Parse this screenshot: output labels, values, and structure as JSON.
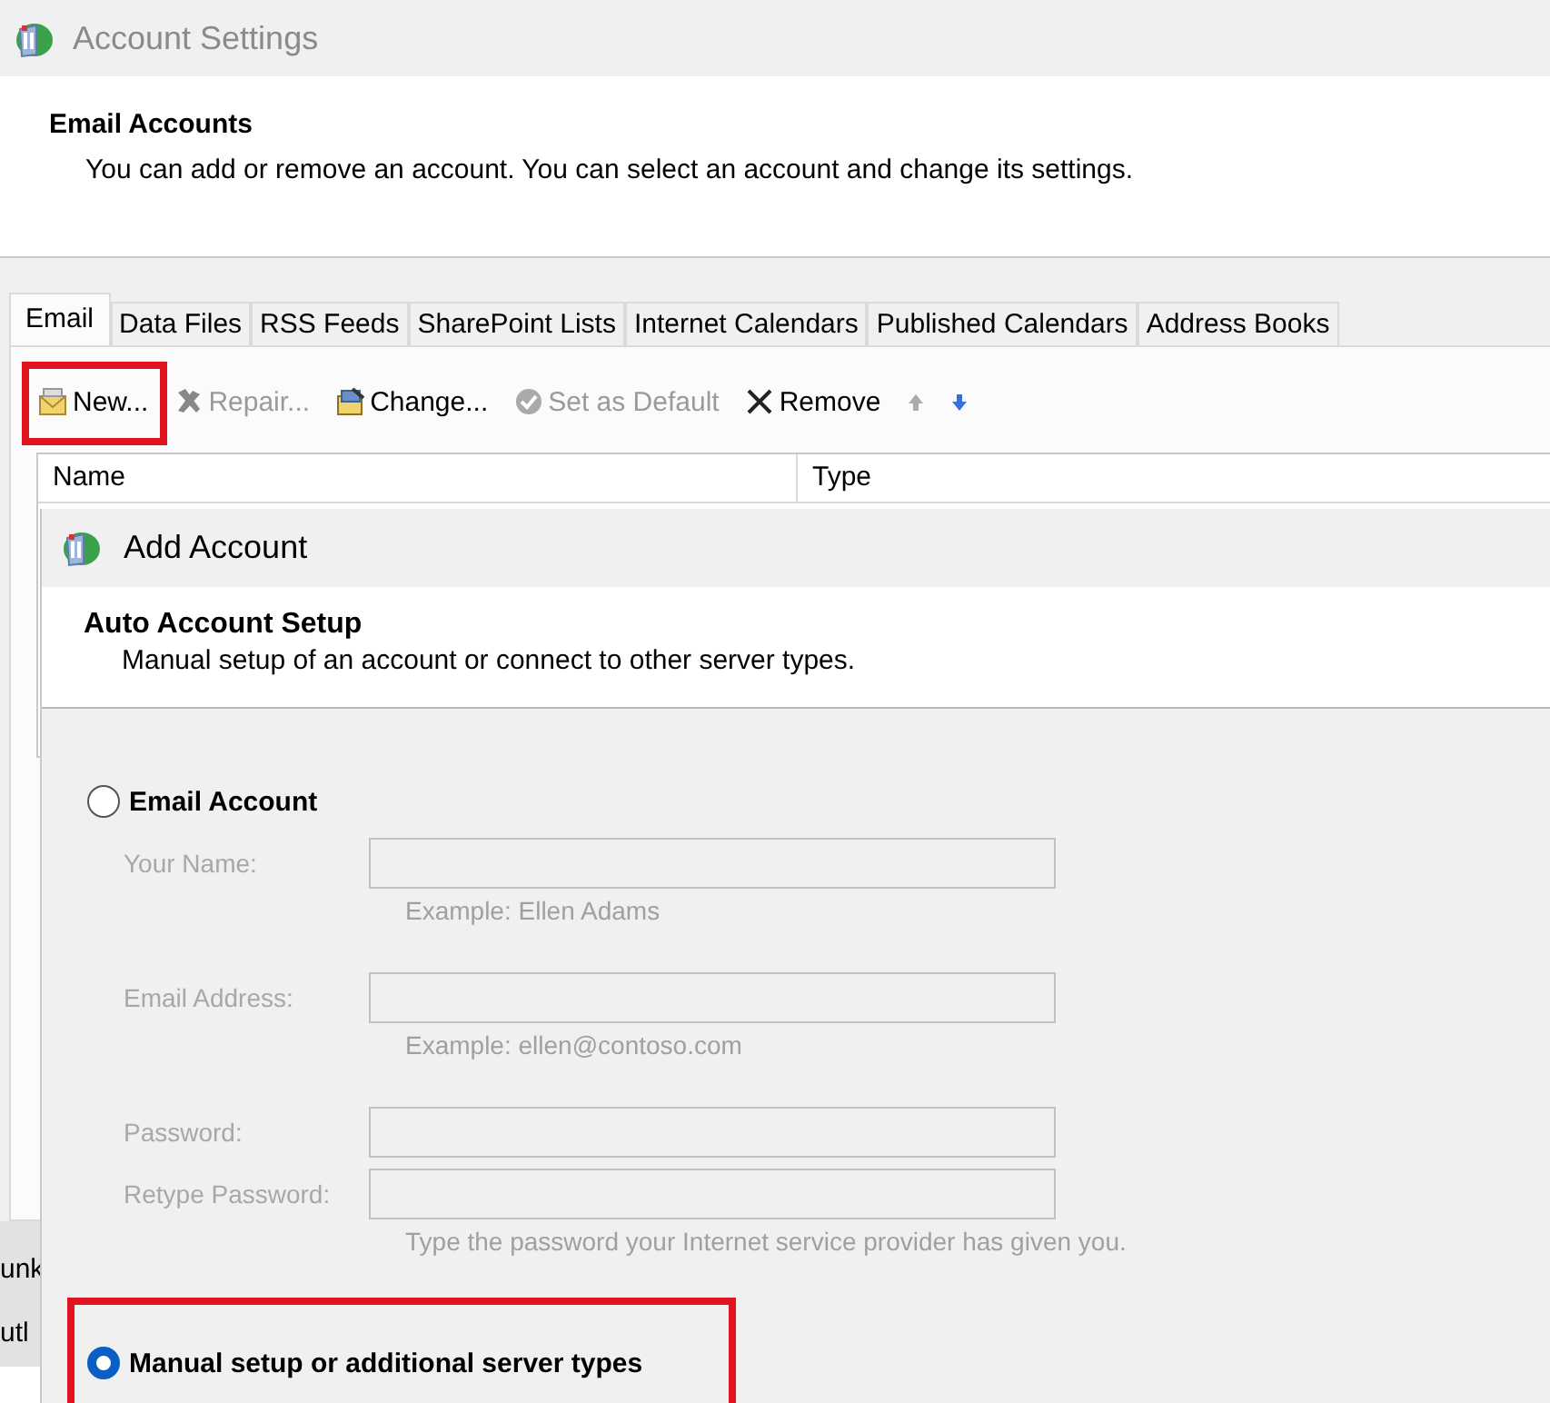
{
  "window": {
    "title": "Account Settings"
  },
  "header": {
    "title": "Email Accounts",
    "description": "You can add or remove an account. You can select an account and change its settings."
  },
  "tabs": [
    {
      "label": "Email",
      "selected": true
    },
    {
      "label": "Data Files",
      "selected": false
    },
    {
      "label": "RSS Feeds",
      "selected": false
    },
    {
      "label": "SharePoint Lists",
      "selected": false
    },
    {
      "label": "Internet Calendars",
      "selected": false
    },
    {
      "label": "Published Calendars",
      "selected": false
    },
    {
      "label": "Address Books",
      "selected": false
    }
  ],
  "toolbar": [
    {
      "kind": "new",
      "label": "New...",
      "disabled": false,
      "highlighted": true
    },
    {
      "kind": "repair",
      "label": "Repair...",
      "disabled": true,
      "highlighted": false
    },
    {
      "kind": "change",
      "label": "Change...",
      "disabled": false,
      "highlighted": false
    },
    {
      "kind": "default",
      "label": "Set as Default",
      "disabled": true,
      "highlighted": false
    },
    {
      "kind": "remove",
      "label": "Remove",
      "disabled": false,
      "highlighted": false
    },
    {
      "kind": "up",
      "disabled": true,
      "highlighted": false
    },
    {
      "kind": "down",
      "disabled": false,
      "highlighted": false
    }
  ],
  "table": {
    "columns": [
      "Name",
      "Type"
    ]
  },
  "obscured_texts": [
    "unk",
    "utl"
  ],
  "dialog": {
    "title": "Add Account",
    "header": {
      "title": "Auto Account Setup",
      "description": "Manual setup of an account or connect to other server types."
    },
    "options": [
      {
        "label": "Email Account",
        "selected": false,
        "highlighted": false,
        "fields": [
          {
            "label": "Your Name:",
            "disabled": true,
            "hint": "Example: Ellen Adams"
          },
          {
            "label": "Email Address:",
            "disabled": true,
            "hint": "Example: ellen@contoso.com"
          },
          {
            "label": "Password:",
            "disabled": true
          },
          {
            "label": "Retype Password:",
            "disabled": true,
            "hint": "Type the password your Internet service provider has given you."
          }
        ]
      },
      {
        "label": "Manual setup or additional server types",
        "selected": true,
        "highlighted": true
      }
    ]
  }
}
